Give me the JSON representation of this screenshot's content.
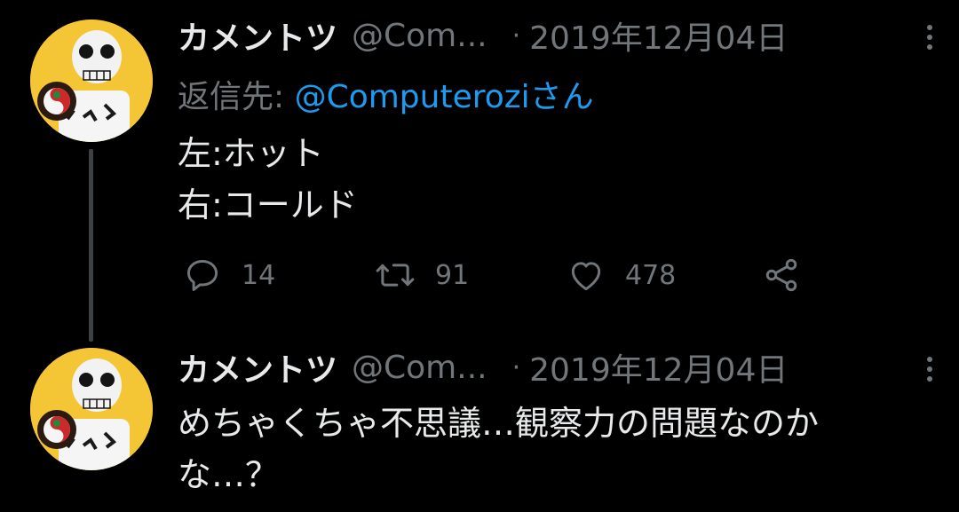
{
  "thread": {
    "tweets": [
      {
        "author_name": "カメントツ",
        "handle": "@Com...",
        "separator": "·",
        "date": "2019年12月04日",
        "reply_label": "返信先: ",
        "reply_mention": "@Computeroziさん",
        "body_lines": [
          "左:ホット",
          "右:コールド"
        ],
        "reply_count": "14",
        "retweet_count": "91",
        "like_count": "478"
      },
      {
        "author_name": "カメントツ",
        "handle": "@Com...",
        "separator": "·",
        "date": "2019年12月04日",
        "body_lines": [
          "めちゃくちゃ不思議…観察力の問題なのか",
          "な…？"
        ]
      }
    ]
  },
  "colors": {
    "background": "#000000",
    "primary_text": "#e7e9ea",
    "secondary_text": "#71767b",
    "link": "#1d9bf0",
    "thread_line": "#3d4146",
    "avatar_bg": "#f4c534"
  },
  "icons": {
    "reply": "speech-bubble-icon",
    "retweet": "retweet-arrows-icon",
    "like": "heart-icon",
    "share": "share-nodes-icon",
    "more": "vertical-dots-icon"
  }
}
